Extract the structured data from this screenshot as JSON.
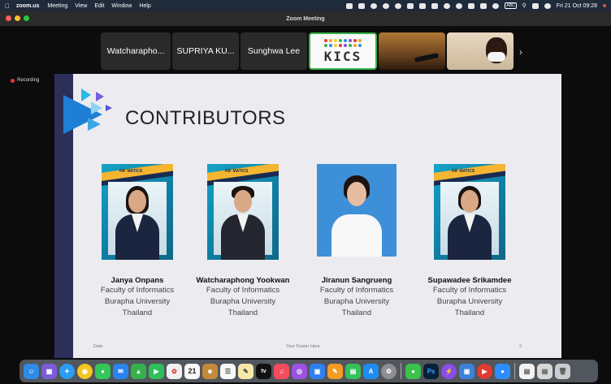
{
  "menubar": {
    "app_name": "zoom.us",
    "menus": [
      "Meeting",
      "View",
      "Edit",
      "Window",
      "Help"
    ],
    "input_badge": "ABC",
    "clock": "Fri 21 Oct  09:28"
  },
  "window": {
    "title": "Zoom Meeting"
  },
  "participants": [
    {
      "name": "Watcharapho..."
    },
    {
      "name": "SUPRIYA KU..."
    },
    {
      "name": "Sunghwa Lee"
    }
  ],
  "kics_tile": {
    "logo_text": "KICS"
  },
  "recording": {
    "label": "Recording"
  },
  "slide": {
    "title": "CONTRIBUTORS",
    "brand_text": "INF   MATICS",
    "contributors": [
      {
        "name": "Janya Onpans",
        "faculty": "Faculty of Informatics",
        "university": "Burapha University",
        "country": "Thailand"
      },
      {
        "name": "Watcharaphong Yookwan",
        "faculty": "Faculty of Informatics",
        "university": "Burapha University",
        "country": "Thailand"
      },
      {
        "name": "Jiranun Sangrueng",
        "faculty": "Faculty of Informatics",
        "university": "Burapha University",
        "country": "Thailand"
      },
      {
        "name": "Supawadee Srikamdee",
        "faculty": "Faculty of Informatics",
        "university": "Burapha University",
        "country": "Thailand"
      }
    ],
    "footer": {
      "date": "Date",
      "center": "Your Footer Here",
      "page": "2"
    }
  },
  "dock": {
    "calendar_day": "21",
    "tv_label": "tv",
    "ps_label": "Ps"
  },
  "colors": {
    "menubar": "#1f2a3a",
    "slide_bar": "#2c2f5a",
    "kics_border": "#38b34a",
    "recording": "#e33333"
  }
}
